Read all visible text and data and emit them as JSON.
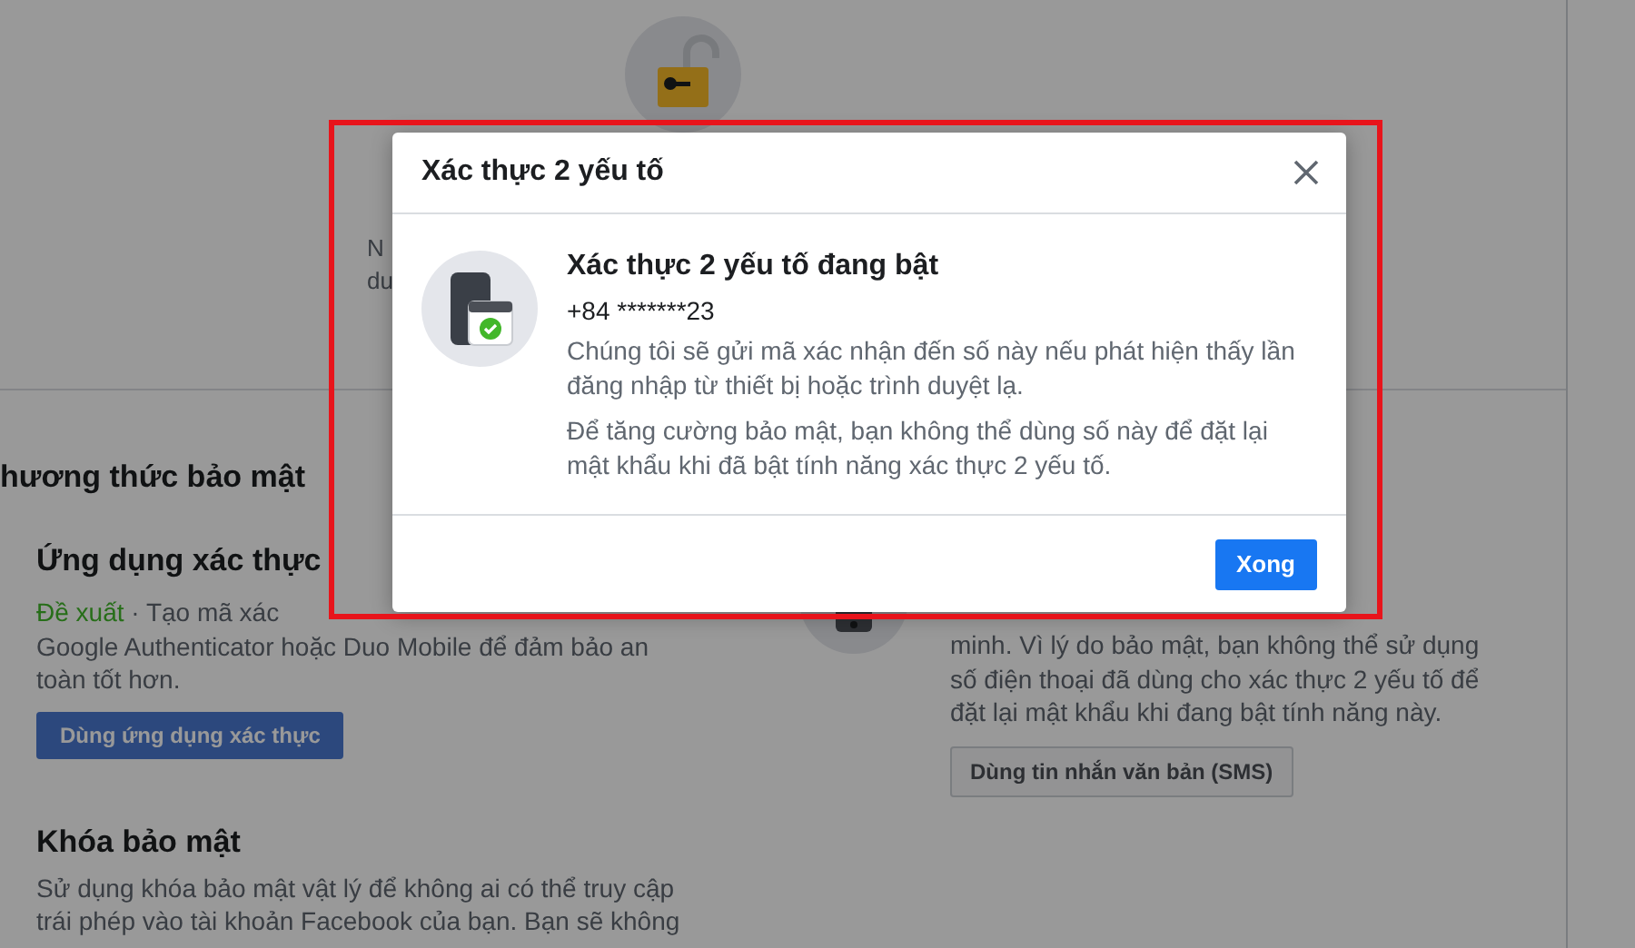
{
  "background": {
    "fragments": [
      "N",
      "du"
    ],
    "section_title": "hương thức bảo mật",
    "authenticator": {
      "title": "Ứng dụng xác thực",
      "tag": "Đề xuất",
      "lines": [
        "· Tạo mã xác",
        "Google Authenticator hoặc Duo Mobile để đảm bảo an",
        "toàn tốt hơn."
      ],
      "button": "Dùng ứng dụng xác thực"
    },
    "sms": {
      "lines": [
        "minh. Vì lý do bảo mật, bạn không thể sử dụng",
        "số điện thoại đã dùng cho xác thực 2 yếu tố để",
        "đặt lại mật khẩu khi đang bật tính năng này."
      ],
      "button": "Dùng tin nhắn văn bản (SMS)"
    },
    "security_key": {
      "title": "Khóa bảo mật",
      "lines": [
        "Sử dụng khóa bảo mật vật lý để không ai có thể truy cập",
        "trái phép vào tài khoản Facebook của bạn. Bạn sẽ không"
      ]
    }
  },
  "dialog": {
    "title": "Xác thực 2 yếu tố",
    "heading": "Xác thực 2 yếu tố đang bật",
    "phone": "+84 *******23",
    "paragraphs": [
      "Chúng tôi sẽ gửi mã xác nhận đến số này nếu phát hiện thấy lần đăng nhập từ thiết bị hoặc trình duyệt lạ.",
      "Để tăng cường bảo mật, bạn không thể dùng số này để đặt lại mật khẩu khi đã bật tính năng xác thực 2 yếu tố."
    ],
    "button": "Xong"
  }
}
